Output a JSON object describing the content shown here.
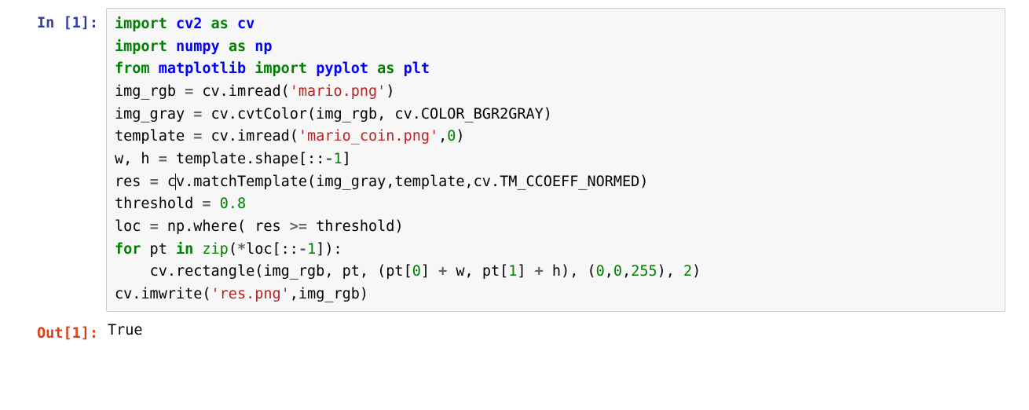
{
  "cell_in": {
    "prompt": "In [1]:",
    "code": {
      "l1": {
        "kw1": "import",
        "mod1": "cv2",
        "kw2": "as",
        "alias1": "cv"
      },
      "l2": {
        "kw1": "import",
        "mod1": "numpy",
        "kw2": "as",
        "alias1": "np"
      },
      "l3": {
        "kw1": "from",
        "mod1": "matplotlib",
        "kw2": "import",
        "mod2": "pyplot",
        "kw3": "as",
        "alias1": "plt"
      },
      "l4": {
        "lhs": "img_rgb ",
        "op": "=",
        "call": " cv.imread(",
        "str": "'mario.png'",
        "end": ")"
      },
      "l5": {
        "lhs": "img_gray ",
        "op": "=",
        "call": " cv.cvtColor(img_rgb, cv.COLOR_BGR2GRAY)"
      },
      "l6": {
        "lhs": "template ",
        "op": "=",
        "call": " cv.imread(",
        "str": "'mario_coin.png'",
        "comma": ",",
        "num": "0",
        "end": ")"
      },
      "l7": {
        "lhs": "w, h ",
        "op": "=",
        "rhs_a": " template.shape[::",
        "neg": "-",
        "one": "1",
        "rhs_b": "]"
      },
      "l8": {
        "lhs": "res ",
        "op": "=",
        "pre": " c",
        "post": "v.matchTemplate(img_gray,template,cv.TM_CCOEFF_NORMED)"
      },
      "l9": {
        "lhs": "threshold ",
        "op": "=",
        "sp": " ",
        "num": "0.8"
      },
      "l10": {
        "lhs": "loc ",
        "op": "=",
        "call_a": " np.where( res ",
        "ge": ">=",
        "call_b": " threshold)"
      },
      "l11": {
        "kw_for": "for",
        "var": " pt ",
        "kw_in": "in",
        "sp": " ",
        "zip": "zip",
        "args_a": "(",
        "star": "*",
        "args_b": "loc[::",
        "neg": "-",
        "one": "1",
        "args_c": "]):"
      },
      "l12": {
        "indent": "    ",
        "call_a": "cv.rectangle(img_rgb, pt, (pt[",
        "n0": "0",
        "mid1": "] ",
        "plus1": "+",
        "mid2": " w, pt[",
        "n1": "1",
        "mid3": "] ",
        "plus2": "+",
        "mid4": " h), (",
        "c0": "0",
        "com1": ",",
        "c1": "0",
        "com2": ",",
        "c2": "255",
        "mid5": "), ",
        "thk": "2",
        "end": ")"
      },
      "l13": {
        "call": "cv.imwrite(",
        "str": "'res.png'",
        "rest": ",img_rgb)"
      }
    }
  },
  "cell_out": {
    "prompt": "Out[1]:",
    "value": "True"
  }
}
